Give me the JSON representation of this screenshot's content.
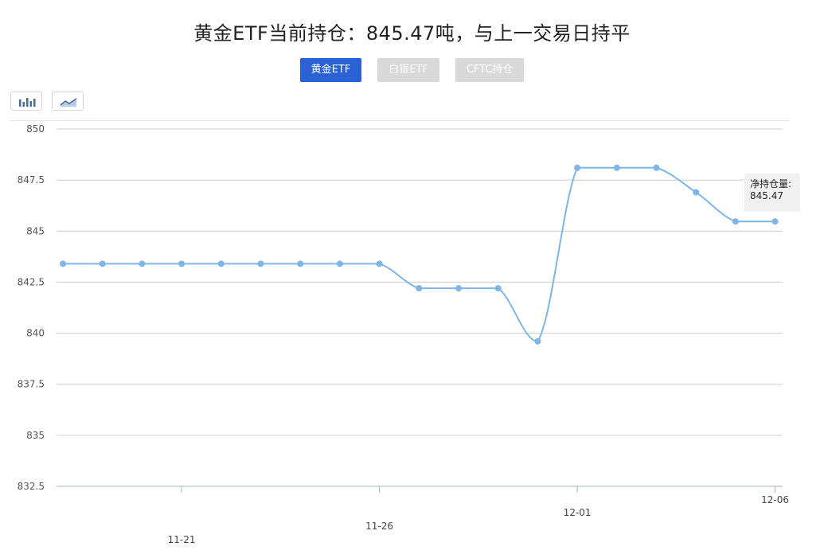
{
  "header": {
    "title": "黄金ETF当前持仓：845.47吨，与上一交易日持平"
  },
  "tabs": [
    {
      "label": "黄金ETF",
      "active": true
    },
    {
      "label": "白银ETF",
      "active": false
    },
    {
      "label": "CFTC持仓",
      "active": false
    }
  ],
  "toolbar": {
    "bar_icon": "bar-chart-icon",
    "line_icon": "line-chart-icon"
  },
  "tooltip": {
    "label": "净持仓量:",
    "value": "845.47"
  },
  "chart_data": {
    "type": "line",
    "title": "",
    "xlabel": "",
    "ylabel": "",
    "ylim": [
      832.5,
      850
    ],
    "yticks": [
      "832.5",
      "835",
      "837.5",
      "840",
      "842.5",
      "845",
      "847.5",
      "850"
    ],
    "xtick_labels": [
      "11-21",
      "11-26",
      "12-01",
      "12-06"
    ],
    "grid": true,
    "color": "#7eb6e8",
    "series": [
      {
        "values": [
          843.4,
          843.4,
          843.4,
          843.4,
          843.4,
          843.4,
          843.4,
          843.4,
          843.4,
          842.2,
          842.2,
          842.2,
          839.6,
          848.1,
          848.1,
          848.1,
          846.9,
          845.47,
          845.47
        ]
      }
    ]
  }
}
